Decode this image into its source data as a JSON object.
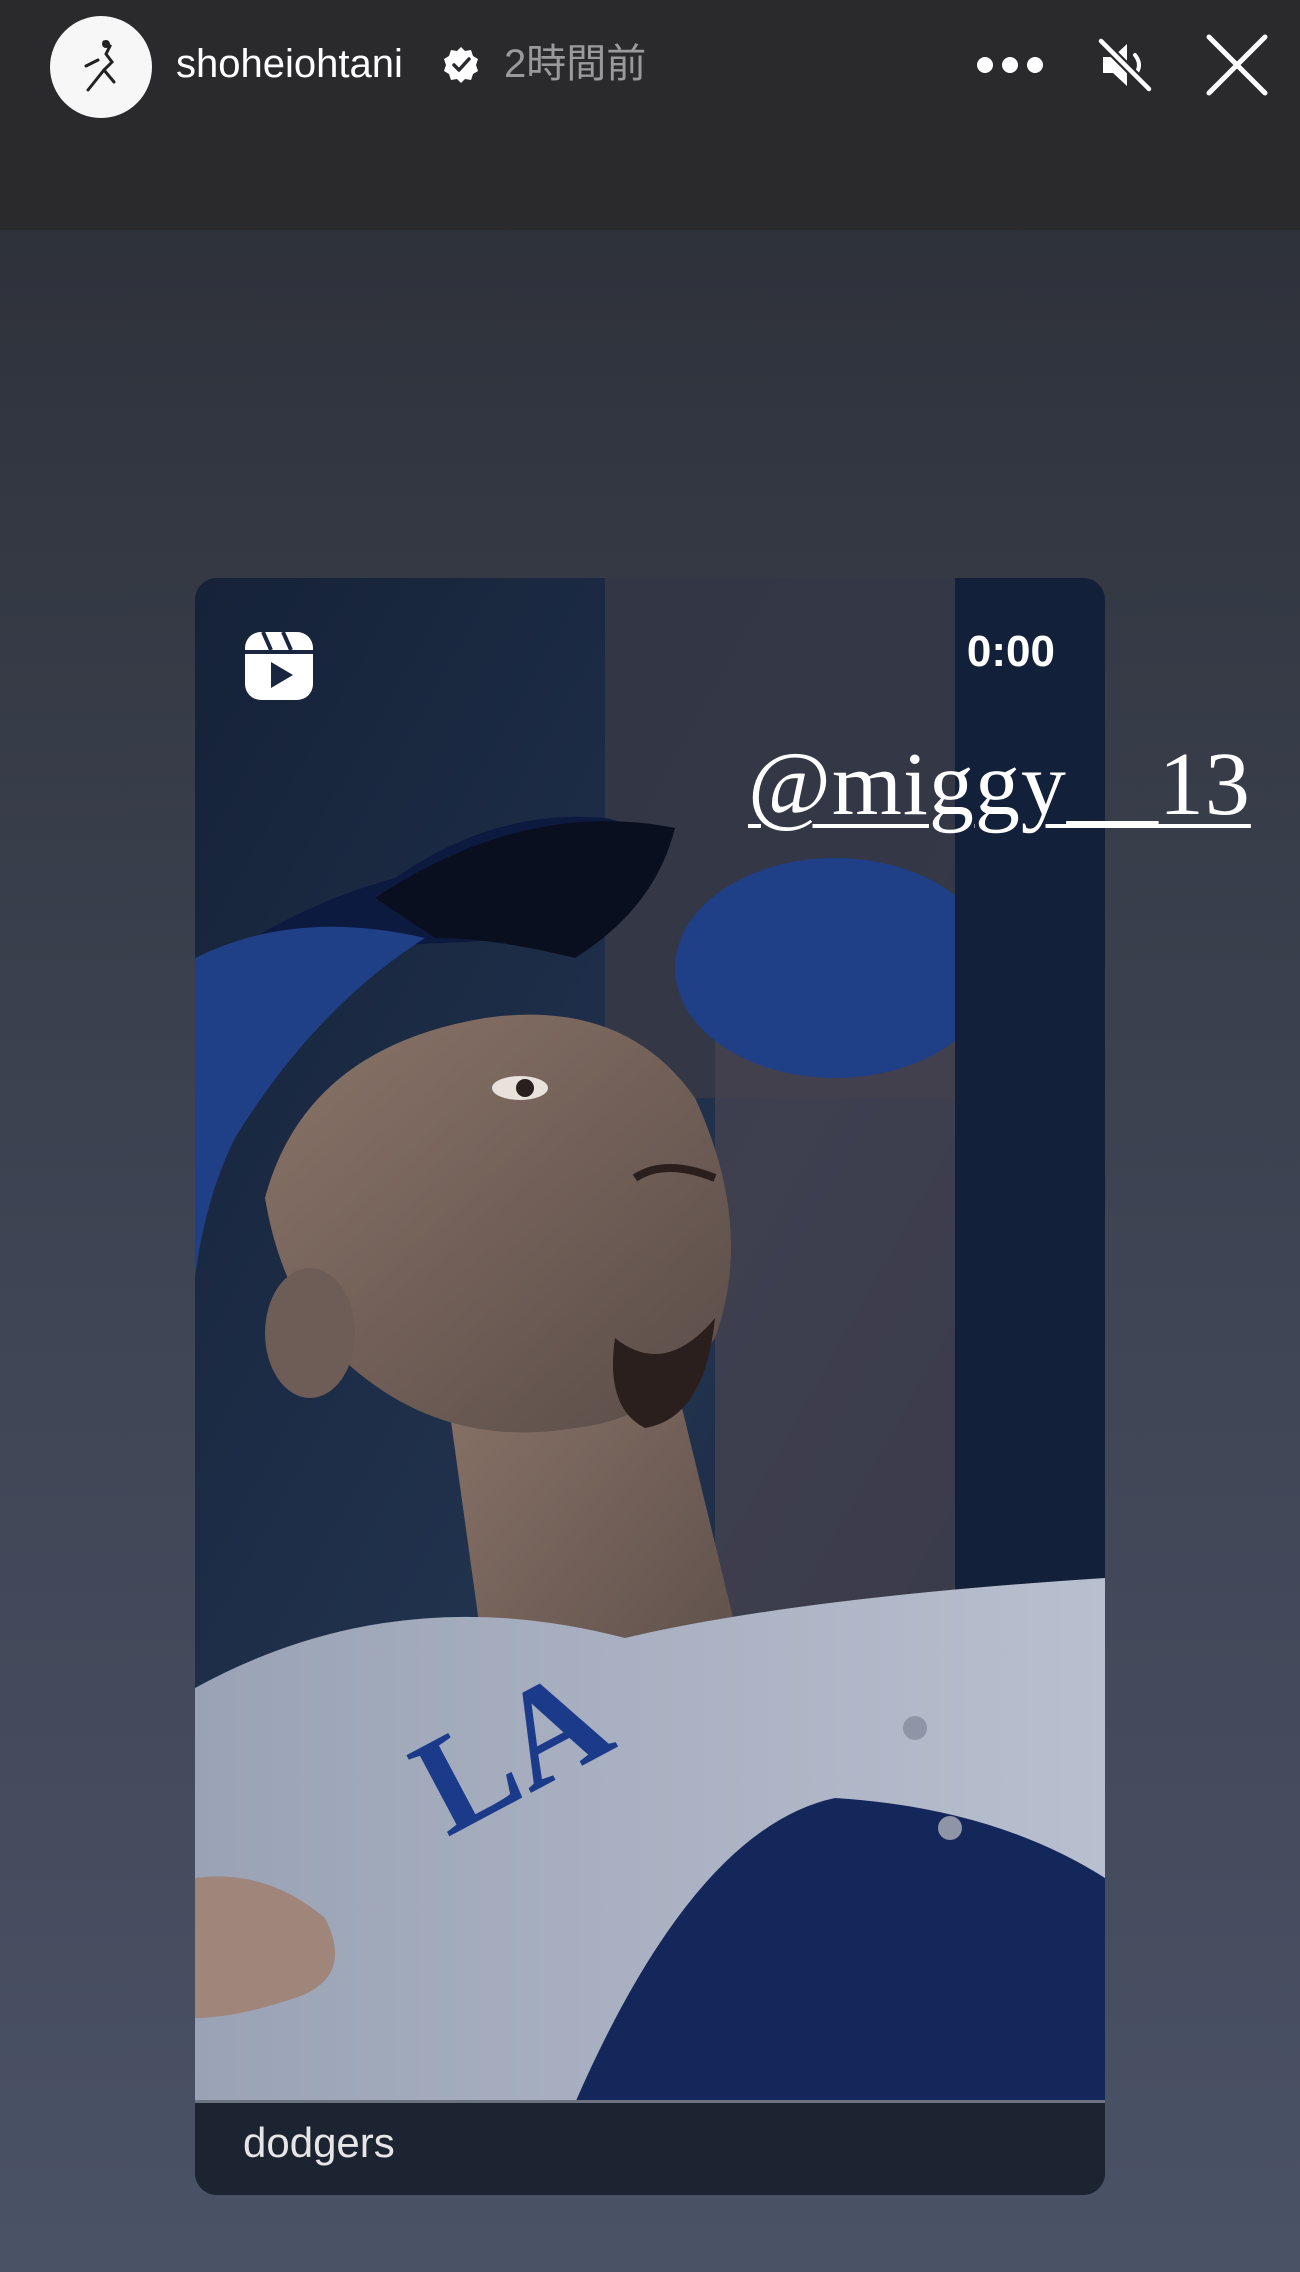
{
  "header": {
    "username": "shoheiohtani",
    "timestamp": "2時間前"
  },
  "story": {
    "video_time": "0:00",
    "mention": "@miggy__13",
    "source_label": "dodgers"
  },
  "icons": {
    "avatar": "avatar-illustration",
    "verified": "verified-badge-icon",
    "more": "more-options-icon",
    "mute": "muted-speaker-icon",
    "close": "close-icon",
    "reels": "reels-icon"
  },
  "colors": {
    "header_bg": "#2a2a2c",
    "background_top": "#2a2c33",
    "background_bottom": "#4a5266",
    "timestamp": "#9a9a9a"
  }
}
